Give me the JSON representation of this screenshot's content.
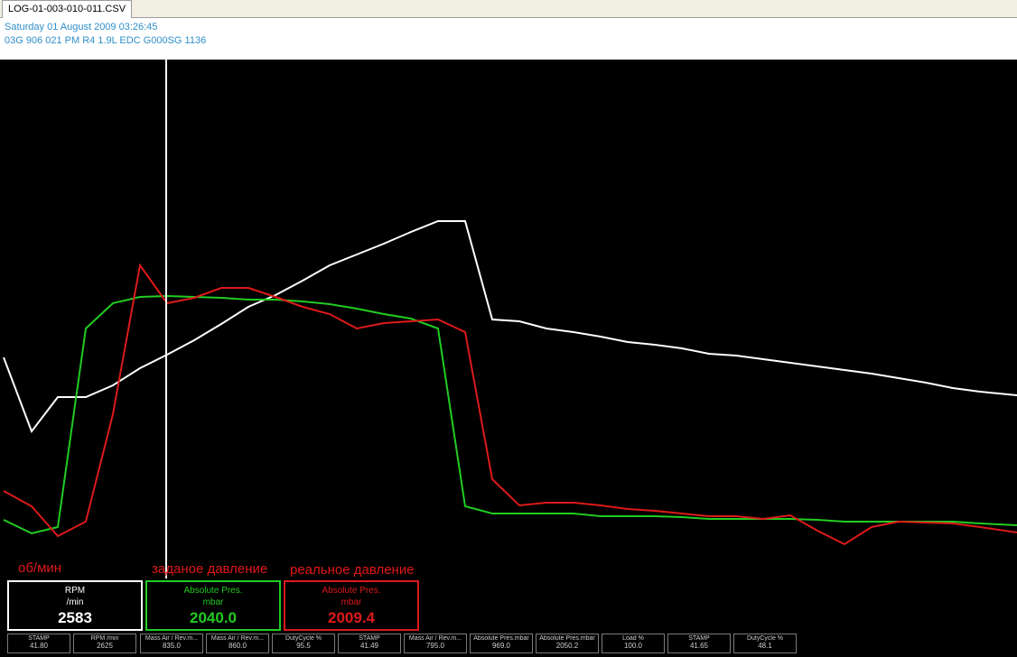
{
  "tab": {
    "label": "LOG-01-003-010-011.CSV"
  },
  "header": {
    "datetime": "Saturday 01 August 2009 03:26:45",
    "ecu": "03G 906 021 PM  R4 1.9L EDC G000SG  1136"
  },
  "annotations": {
    "rpm": "об/мин",
    "target": "заданое давление",
    "actual": "реальное давление"
  },
  "colors": {
    "rpm": "#ffffff",
    "target": "#22cc22",
    "actual": "#dd1a1a",
    "annotation": "#e01818"
  },
  "gauges": [
    {
      "name": "RPM",
      "unit": "/min",
      "value": "2583",
      "color": "#ffffff"
    },
    {
      "name": "Absolute Pres.",
      "unit": "mbar",
      "value": "2040.0",
      "color": "#22cc22"
    },
    {
      "name": "Absolute Pres.",
      "unit": "mbar",
      "value": "2009.4",
      "color": "#dd1a1a"
    }
  ],
  "mini": [
    {
      "name": "STAMP",
      "value": "41.80"
    },
    {
      "name": "RPM /min",
      "value": "2625"
    },
    {
      "name": "Mass Air / Rev.m...",
      "value": "835.0"
    },
    {
      "name": "Mass Air / Rev.m...",
      "value": "860.0"
    },
    {
      "name": "DutyCycle %",
      "value": "95.5"
    },
    {
      "name": "STAMP",
      "value": "41.49"
    },
    {
      "name": "Mass Air / Rev.m...",
      "value": "795.0"
    },
    {
      "name": "Absolute Pres.mbar",
      "value": "969.0"
    },
    {
      "name": "Absolute Pres.mbar",
      "value": "2050.2"
    },
    {
      "name": "Load %",
      "value": "100.0"
    },
    {
      "name": "STAMP",
      "value": "41.65"
    },
    {
      "name": "DutyCycle %",
      "value": "48.1"
    }
  ]
}
